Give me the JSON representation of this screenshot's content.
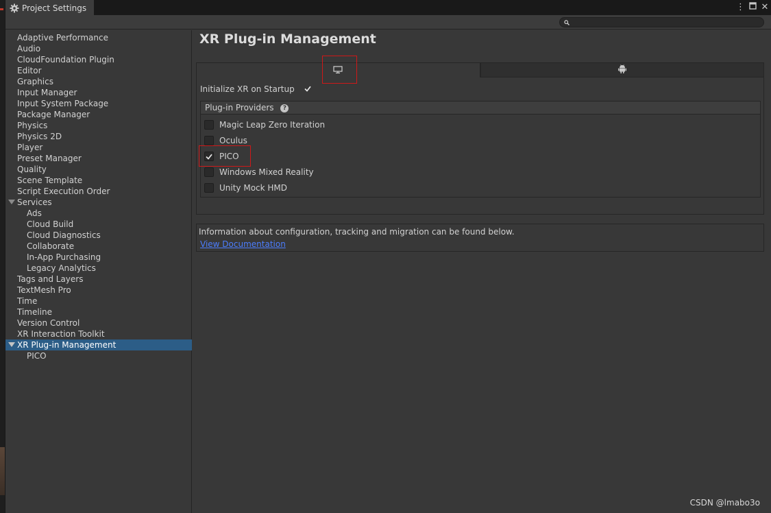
{
  "window": {
    "tab_title": "Project Settings"
  },
  "search": {
    "placeholder": "",
    "value": ""
  },
  "sidebar": {
    "items": [
      {
        "label": "Adaptive Performance",
        "indent": 0
      },
      {
        "label": "Audio",
        "indent": 0
      },
      {
        "label": "CloudFoundation Plugin",
        "indent": 0
      },
      {
        "label": "Editor",
        "indent": 0
      },
      {
        "label": "Graphics",
        "indent": 0
      },
      {
        "label": "Input Manager",
        "indent": 0
      },
      {
        "label": "Input System Package",
        "indent": 0
      },
      {
        "label": "Package Manager",
        "indent": 0
      },
      {
        "label": "Physics",
        "indent": 0
      },
      {
        "label": "Physics 2D",
        "indent": 0
      },
      {
        "label": "Player",
        "indent": 0
      },
      {
        "label": "Preset Manager",
        "indent": 0
      },
      {
        "label": "Quality",
        "indent": 0
      },
      {
        "label": "Scene Template",
        "indent": 0
      },
      {
        "label": "Script Execution Order",
        "indent": 0
      },
      {
        "label": "Services",
        "indent": 0,
        "expanded": true
      },
      {
        "label": "Ads",
        "indent": 1
      },
      {
        "label": "Cloud Build",
        "indent": 1
      },
      {
        "label": "Cloud Diagnostics",
        "indent": 1
      },
      {
        "label": "Collaborate",
        "indent": 1
      },
      {
        "label": "In-App Purchasing",
        "indent": 1
      },
      {
        "label": "Legacy Analytics",
        "indent": 1
      },
      {
        "label": "Tags and Layers",
        "indent": 0
      },
      {
        "label": "TextMesh Pro",
        "indent": 0
      },
      {
        "label": "Time",
        "indent": 0
      },
      {
        "label": "Timeline",
        "indent": 0
      },
      {
        "label": "Version Control",
        "indent": 0
      },
      {
        "label": "XR Interaction Toolkit",
        "indent": 0
      },
      {
        "label": "XR Plug-in Management",
        "indent": 0,
        "expanded": true,
        "selected": true
      },
      {
        "label": "PICO",
        "indent": 1
      }
    ]
  },
  "main": {
    "title": "XR Plug-in Management",
    "platform_tabs": [
      {
        "icon": "desktop-icon",
        "active": true
      },
      {
        "icon": "android-icon",
        "active": false
      }
    ],
    "init_on_startup": {
      "label": "Initialize XR on Startup",
      "checked": true
    },
    "providers": {
      "header": "Plug-in Providers",
      "items": [
        {
          "label": "Magic Leap Zero Iteration",
          "checked": false
        },
        {
          "label": "Oculus",
          "checked": false
        },
        {
          "label": "PICO",
          "checked": true
        },
        {
          "label": "Windows Mixed Reality",
          "checked": false
        },
        {
          "label": "Unity Mock HMD",
          "checked": false
        }
      ]
    },
    "info": {
      "text": "Information about configuration, tracking and migration can be found below.",
      "link": "View Documentation"
    }
  },
  "watermark": "CSDN @lmabo3o",
  "colors": {
    "selection": "#2c5d87",
    "highlight": "#d01818",
    "link": "#4c7eff"
  }
}
